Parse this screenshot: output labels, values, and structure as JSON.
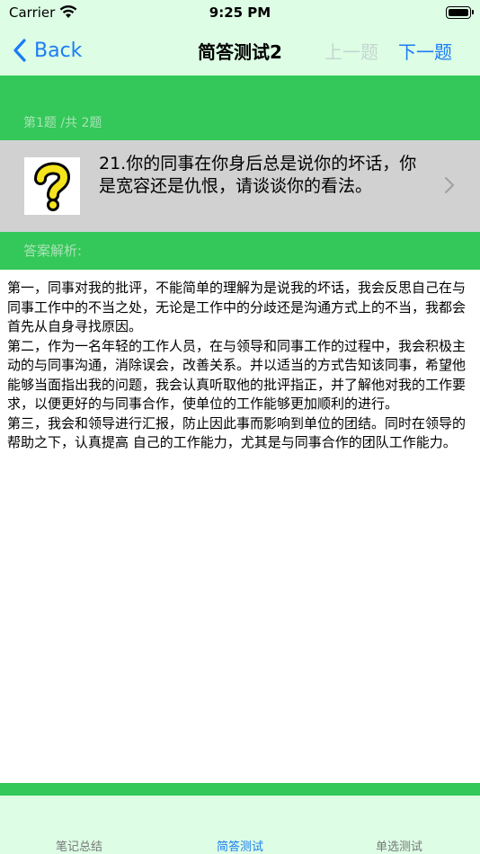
{
  "status_bar": {
    "carrier": "Carrier",
    "time": "9:25 PM",
    "icons": [
      "wifi-icon",
      "battery-icon"
    ]
  },
  "nav_bar": {
    "back_label": "Back",
    "title": "简答测试2",
    "prev_label": "上一题",
    "next_label": "下一题"
  },
  "question": {
    "counter": "第1题 /共 2题",
    "icon": "question-mark-icon",
    "text": "21.你的同事在你身后总是说你的坏话，你是宽容还是仇恨，请谈谈你的看法。"
  },
  "answer": {
    "label": "答案解析:",
    "text": "第一，同事对我的批评，不能简单的理解为是说我的坏话，我会反思自己在与同事工作中的不当之处，无论是工作中的分歧还是沟通方式上的不当，我都会首先从自身寻找原因。\n第二，作为一名年轻的工作人员，在与领导和同事工作的过程中，我会积极主动的与同事沟通，消除误会，改善关系。并以适当的方式告知该同事，希望他能够当面指出我的问题，我会认真听取他的批评指正，并了解他对我的工作要求，以便更好的与同事合作，使单位的工作能够更加顺利的进行。\n第三，我会和领导进行汇报，防止因此事而影响到单位的团结。同时在领导的帮助之下，认真提高 自己的工作能力，尤其是与同事合作的团队工作能力。"
  },
  "tabs": [
    {
      "label": "笔记总结",
      "active": false
    },
    {
      "label": "简答测试",
      "active": true
    },
    {
      "label": "单选测试",
      "active": false
    }
  ],
  "colors": {
    "accent": "#1a7cf5",
    "green": "#34c759",
    "bar_bg": "#ddfde5",
    "question_bg": "#d1d1d1",
    "disabled": "#c4d6d0"
  }
}
